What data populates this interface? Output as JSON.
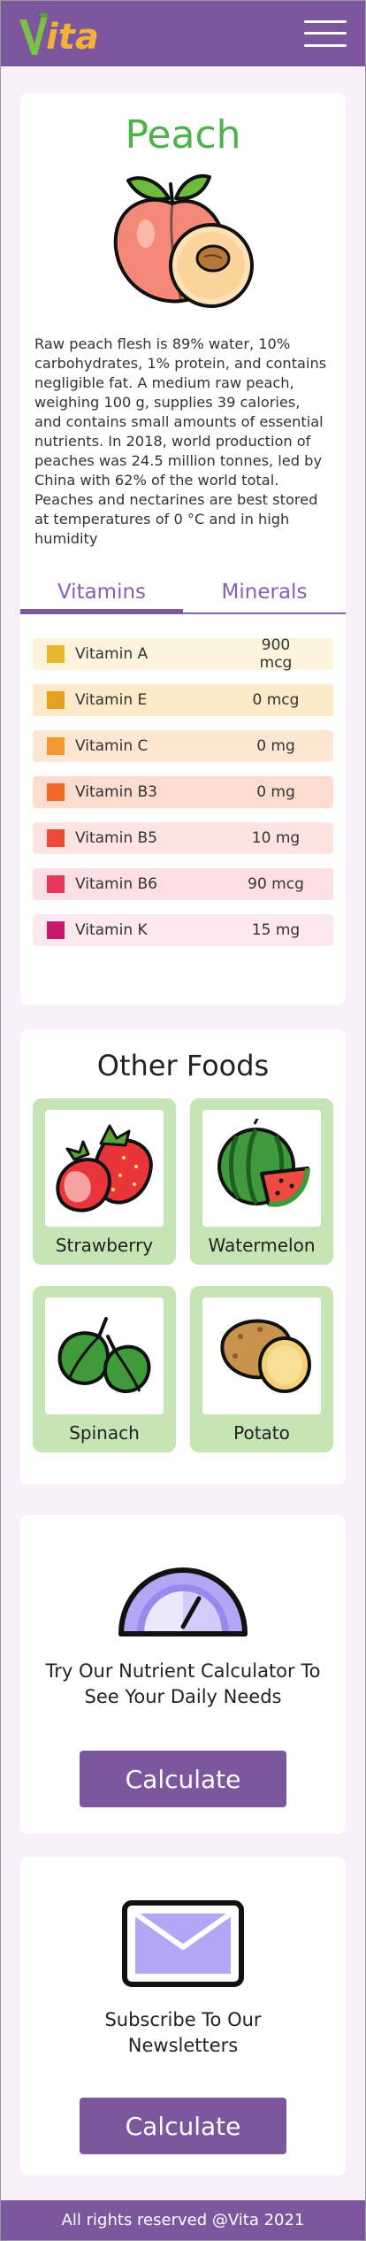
{
  "header": {
    "logo_text": "ita",
    "brand_color": "#7c579e",
    "logo_accent": "#f2b13a",
    "logo_v_color": "#7cc242",
    "menu_icon": "hamburger-menu-icon"
  },
  "food": {
    "name": "Peach",
    "image_icon": "peach-icon",
    "description": "Raw peach flesh is 89% water, 10% carbohydrates, 1% protein, and contains negligible fat. A medium raw peach, weighing 100 g, supplies 39 calories, and contains small amounts of essential nutrients. In 2018, world production of peaches was 24.5 million tonnes, led by China with 62% of the world total. Peaches and nectarines are best stored at temperatures of 0 °C and in high humidity"
  },
  "tabs": [
    {
      "label": "Vitamins",
      "active": true
    },
    {
      "label": "Minerals",
      "active": false
    }
  ],
  "vitamins": [
    {
      "name": "Vitamin A",
      "value": "900 mcg",
      "swatch": "#e6b830",
      "bg": "#fdf3dc"
    },
    {
      "name": "Vitamin E",
      "value": "0 mcg",
      "swatch": "#e8a020",
      "bg": "#fdeacb"
    },
    {
      "name": "Vitamin C",
      "value": "0 mg",
      "swatch": "#f29a30",
      "bg": "#fde7d2"
    },
    {
      "name": "Vitamin B3",
      "value": "0 mg",
      "swatch": "#f26a28",
      "bg": "#fddcd0"
    },
    {
      "name": "Vitamin B5",
      "value": "10 mg",
      "swatch": "#ee4a3a",
      "bg": "#fde4e0"
    },
    {
      "name": "Vitamin B6",
      "value": "90 mcg",
      "swatch": "#e8365a",
      "bg": "#fde0e6"
    },
    {
      "name": "Vitamin K",
      "value": "15 mg",
      "swatch": "#c8186e",
      "bg": "#fde8f0"
    }
  ],
  "other_foods": {
    "title": "Other Foods",
    "items": [
      {
        "label": "Strawberry",
        "icon": "strawberry-icon"
      },
      {
        "label": "Watermelon",
        "icon": "watermelon-icon"
      },
      {
        "label": "Spinach",
        "icon": "spinach-icon"
      },
      {
        "label": "Potato",
        "icon": "potato-icon"
      }
    ]
  },
  "calculator": {
    "icon": "gauge-icon",
    "text": "Try Our Nutrient Calculator To See Your Daily Needs",
    "button_label": "Calculate"
  },
  "newsletter": {
    "icon": "envelope-icon",
    "text": "Subscribe To Our Newsletters",
    "button_label": "Calculate"
  },
  "footer": {
    "text": "All rights reserved @Vita 2021"
  }
}
